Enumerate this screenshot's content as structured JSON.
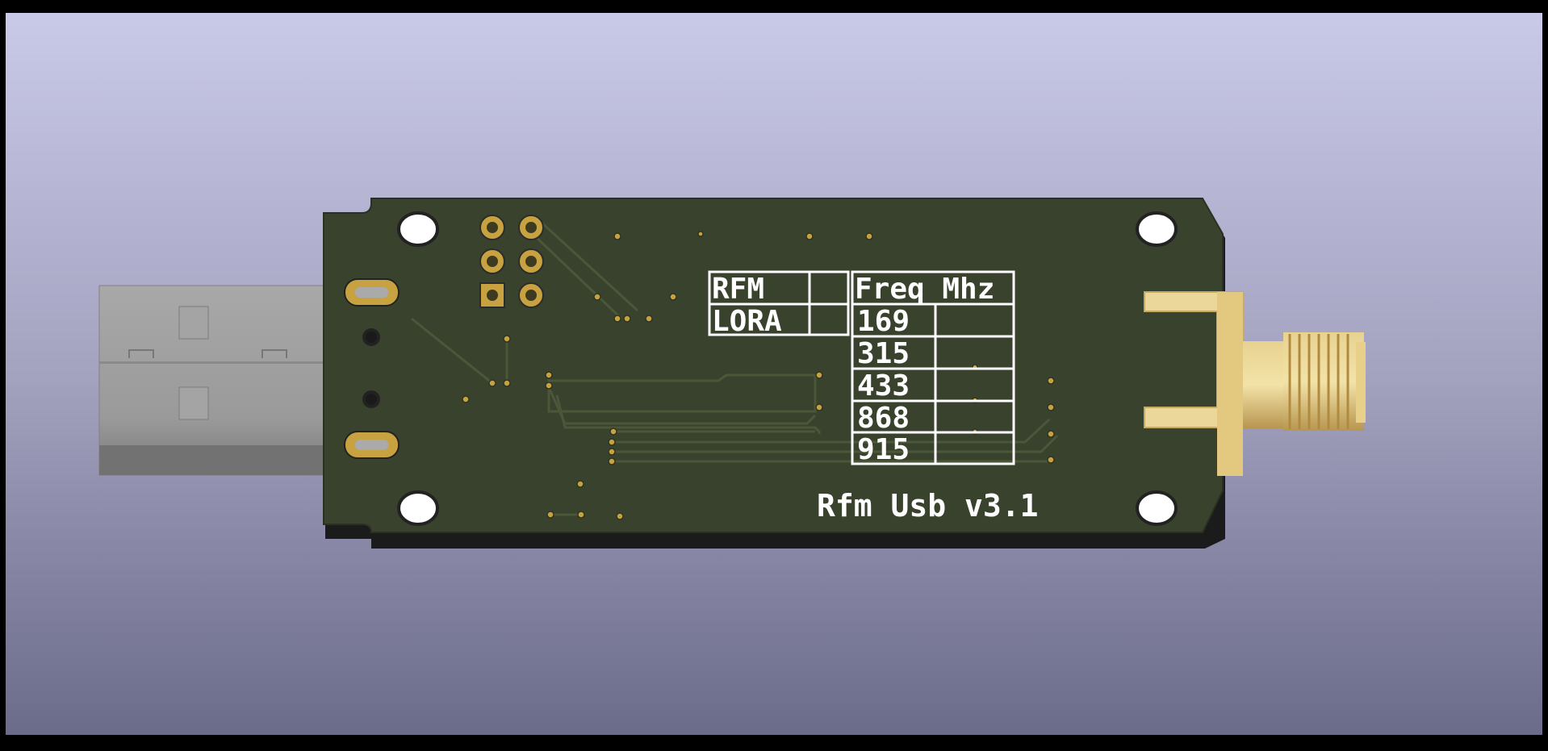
{
  "board": {
    "title": "Rfm Usb v3.1",
    "module_table": {
      "rows": [
        "RFM",
        "LORA"
      ]
    },
    "freq_table": {
      "header": "Freq Mhz",
      "values": [
        "169",
        "315",
        "433",
        "868",
        "915"
      ]
    }
  },
  "colors": {
    "background_top": "#c8c8e6",
    "background_bottom": "#6e6e8c",
    "pcb": "#39422d",
    "silkscreen": "#ffffff",
    "gold": "#c8a240",
    "usb_metal": "#9c9c9c",
    "sma_gold": "#e6c878"
  }
}
